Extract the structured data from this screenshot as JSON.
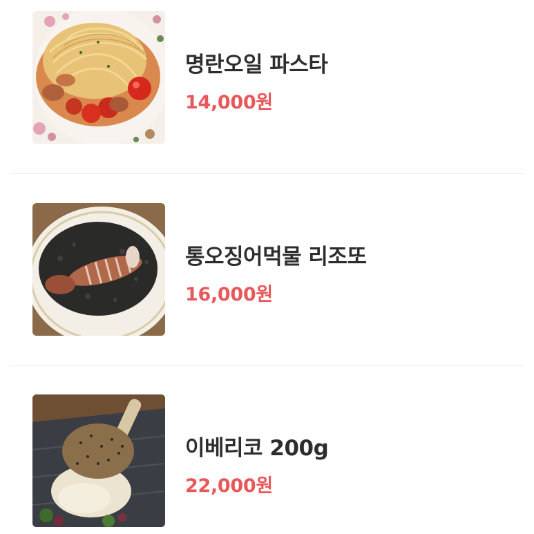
{
  "menu": {
    "items": [
      {
        "name": "명란오일 파스타",
        "price": "14,000원",
        "image_icon": "pasta-photo"
      },
      {
        "name": "통오징어먹물 리조또",
        "price": "16,000원",
        "image_icon": "squid-ink-risotto-photo"
      },
      {
        "name": "이베리코 200g",
        "price": "22,000원",
        "image_icon": "iberico-pork-photo"
      }
    ]
  },
  "colors": {
    "price": "#e8575a",
    "name": "#2d2d2d",
    "divider": "#ebebeb"
  }
}
